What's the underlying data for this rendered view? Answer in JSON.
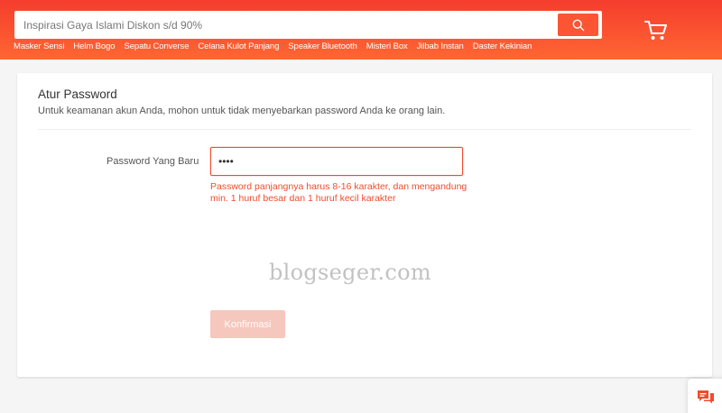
{
  "header": {
    "search": {
      "placeholder": "Inspirasi Gaya Islami Diskon s/d 90%",
      "button_icon": "search-icon"
    },
    "cart_icon": "cart-icon",
    "keywords": [
      "Masker Sensi",
      "Helm Bogo",
      "Sepatu Converse",
      "Celana Kulot Panjang",
      "Speaker Bluetooth",
      "Misteri Box",
      "Jilbab Instan",
      "Daster Kekinian"
    ]
  },
  "form": {
    "title": "Atur Password",
    "subtitle": "Untuk keamanan akun Anda, mohon untuk tidak menyebarkan password Anda ke orang lain.",
    "new_password_label": "Password Yang Baru",
    "new_password_value": "••••",
    "error": "Password panjangnya harus 8-16 karakter, dan mengandung min. 1 huruf besar dan 1 huruf kecil karakter",
    "confirm_label": "Konfirmasi"
  },
  "watermark": "blogseger.com",
  "chat_icon": "chat-icon",
  "colors": {
    "brand": "#ee4d2d",
    "header_top": "#f53d2d",
    "header_bottom": "#ff6633",
    "button_disabled": "#f6c7bd"
  }
}
